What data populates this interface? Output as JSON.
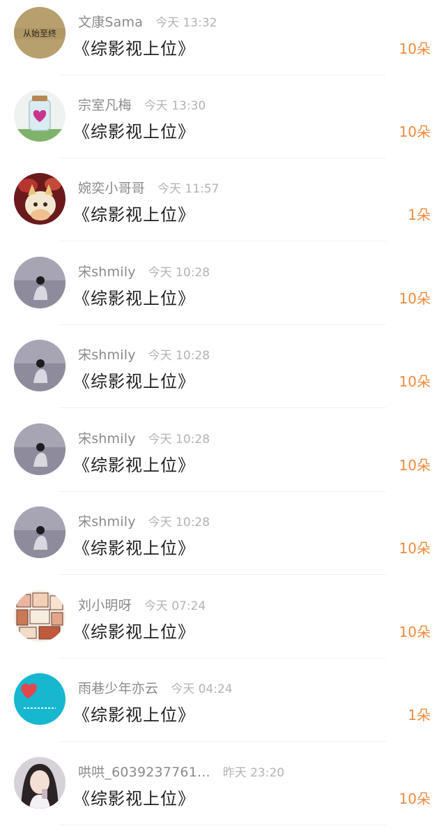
{
  "records": [
    {
      "name": "文康Sama",
      "time": "今天 13:32",
      "message": "《综影视上位》",
      "amount": "10朵",
      "avatar": "avatar-text-badge",
      "avatar_text": "从始至终"
    },
    {
      "name": "宗室凡梅",
      "time": "今天 13:30",
      "message": "《综影视上位》",
      "amount": "10朵",
      "avatar": "avatar-heart-jar"
    },
    {
      "name": "婉奕小哥哥",
      "time": "今天 11:57",
      "message": "《综影视上位》",
      "amount": "1朵",
      "avatar": "avatar-cat"
    },
    {
      "name": "宋shmily",
      "time": "今天 10:28",
      "message": "《综影视上位》",
      "amount": "10朵",
      "avatar": "avatar-person-sea"
    },
    {
      "name": "宋shmily",
      "time": "今天 10:28",
      "message": "《综影视上位》",
      "amount": "10朵",
      "avatar": "avatar-person-sea"
    },
    {
      "name": "宋shmily",
      "time": "今天 10:28",
      "message": "《综影视上位》",
      "amount": "10朵",
      "avatar": "avatar-person-sea"
    },
    {
      "name": "宋shmily",
      "time": "今天 10:28",
      "message": "《综影视上位》",
      "amount": "10朵",
      "avatar": "avatar-person-sea"
    },
    {
      "name": "刘小明呀",
      "time": "今天 07:24",
      "message": "《综影视上位》",
      "amount": "10朵",
      "avatar": "avatar-comic-collage"
    },
    {
      "name": "雨巷少年亦云",
      "time": "今天 04:24",
      "message": "《综影视上位》",
      "amount": "1朵",
      "avatar": "avatar-blue-heart"
    },
    {
      "name": "哄哄_6039237761...",
      "time": "昨天 23:20",
      "message": "《综影视上位》",
      "amount": "10朵",
      "avatar": "avatar-girl-portrait"
    }
  ],
  "colors": {
    "name": "#8a8a8a",
    "time": "#b3b3b3",
    "message": "#1f1f1f",
    "amount": "#ef8a3f",
    "divider": "#f1f1f1"
  }
}
